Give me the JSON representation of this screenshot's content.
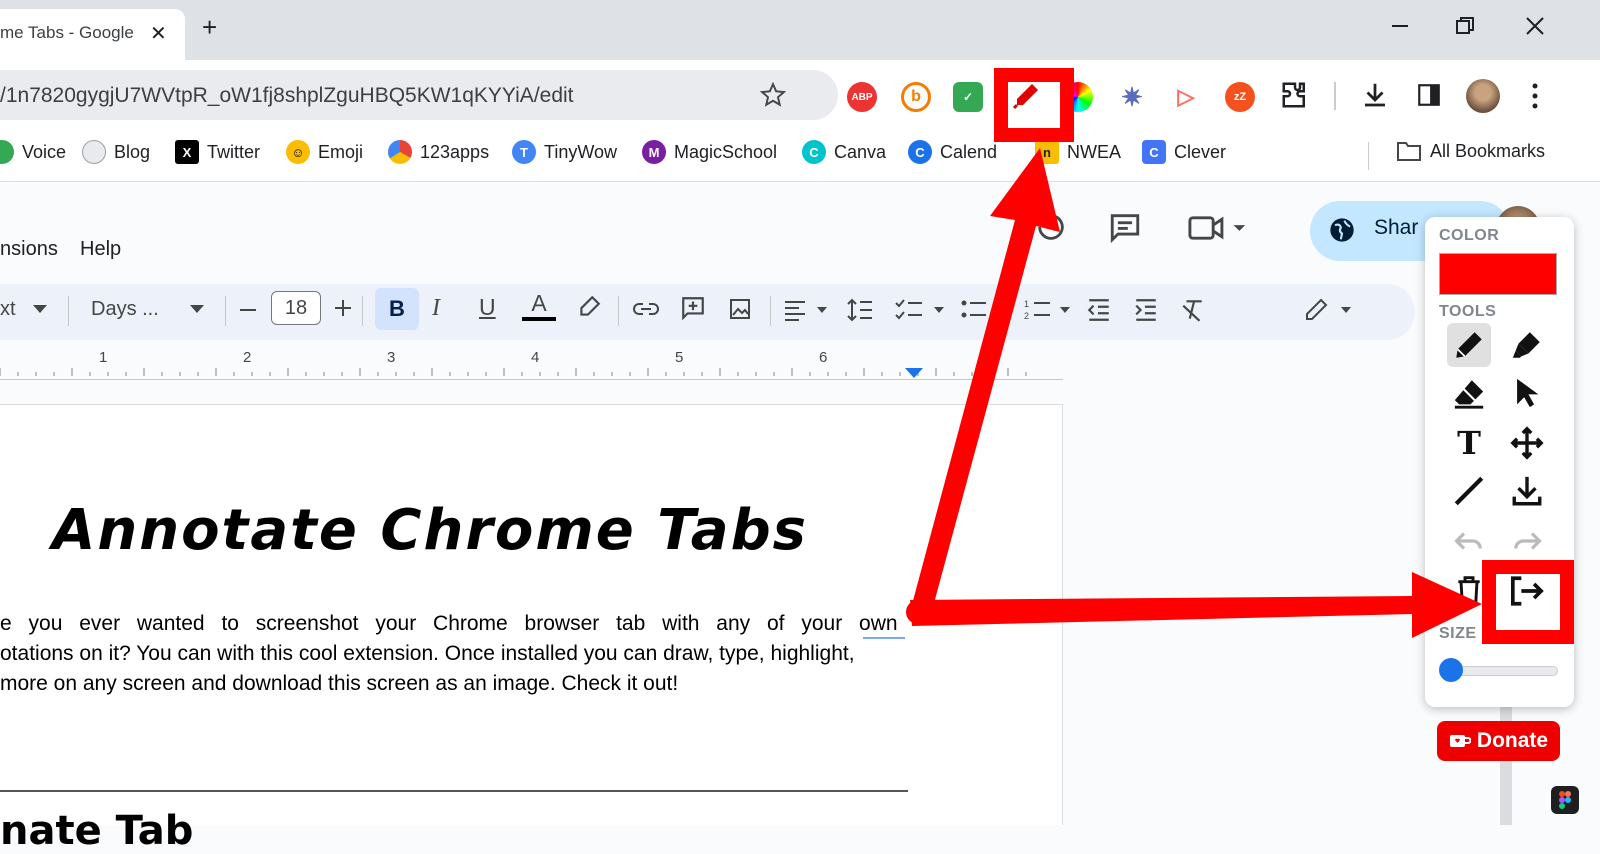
{
  "browser": {
    "tab_title": "me Tabs - Google",
    "new_tab_symbol": "+",
    "url": "/1n7820gygjU7WVtpR_oW1fj8shplZguHBQ5KW1qKYYiA/edit",
    "extensions": [
      {
        "name": "adblock-plus",
        "label": "ABP",
        "color": "#e33"
      },
      {
        "name": "bitmoji",
        "label": "b",
        "color": "#f57c00"
      },
      {
        "name": "green-ext",
        "label": "✓",
        "color": "#34a853"
      },
      {
        "name": "color-wheel",
        "label": "◉",
        "color": "#9c27b0"
      },
      {
        "name": "star-ext",
        "label": "✷",
        "color": "#5c6bc0"
      },
      {
        "name": "screencast",
        "label": "▷",
        "color": "#ff6f61"
      },
      {
        "name": "snooze",
        "label": "zZ",
        "color": "#f4511e"
      }
    ]
  },
  "bookmarks": [
    {
      "label": "Voice",
      "icon_color": "#34a853",
      "icon_text": ""
    },
    {
      "label": "Blog",
      "icon_color": "#9aa0a6",
      "icon_text": ""
    },
    {
      "label": "Twitter",
      "icon_color": "#000000",
      "icon_text": "X"
    },
    {
      "label": "Emoji",
      "icon_color": "#fbbc04",
      "icon_text": "☺"
    },
    {
      "label": "123apps",
      "icon_color": "#ea4335",
      "icon_text": ""
    },
    {
      "label": "TinyWow",
      "icon_color": "#4285f4",
      "icon_text": "T"
    },
    {
      "label": "MagicSchool",
      "icon_color": "#7b1fa2",
      "icon_text": "M"
    },
    {
      "label": "Canva",
      "icon_color": "#00c4cc",
      "icon_text": "C"
    },
    {
      "label": "Calend",
      "icon_color": "#1a73e8",
      "icon_text": "C"
    },
    {
      "label": "NWEA",
      "icon_color": "#222222",
      "icon_text": "n"
    },
    {
      "label": "Clever",
      "icon_color": "#4274f6",
      "icon_text": "C"
    }
  ],
  "all_bookmarks_label": "All Bookmarks",
  "docs": {
    "menu_items": [
      "nsions",
      "Help"
    ],
    "share_label": "Shar",
    "font_style": "xt",
    "font_name": "Days ...",
    "font_size": "18",
    "ruler_numbers": [
      "1",
      "2",
      "3",
      "4",
      "5",
      "6"
    ],
    "title": "Annotate Chrome Tabs",
    "paragraph_lines": [
      "e you ever wanted to screenshot your Chrome browser tab with any of your own",
      "otations on it? You can with this cool extension. Once installed you can draw, type, highlight,",
      " more on any screen and download this screen as an image. Check it out!"
    ],
    "next_heading": "nate Tab"
  },
  "annotate_panel": {
    "color_label": "COLOR",
    "selected_color": "#ff0000",
    "tools_label": "TOOLS",
    "size_label": "SIZE",
    "size_value": 0.12,
    "donate_label": "Donate"
  }
}
